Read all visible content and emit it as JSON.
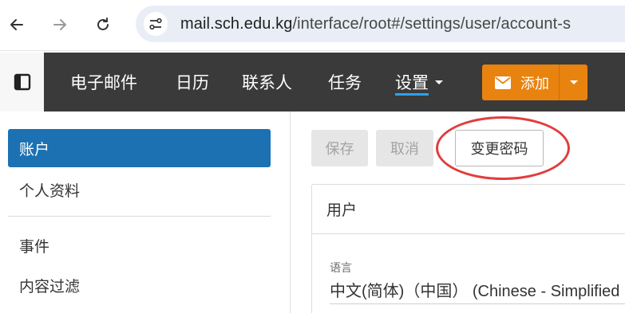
{
  "browser": {
    "back_icon": "arrow-left-icon",
    "forward_icon": "arrow-right-icon",
    "reload_icon": "reload-icon",
    "site_info_icon": "tune-icon",
    "url_host": "mail.sch.edu.kg",
    "url_path": "/interface/root#/settings/user/account-s"
  },
  "nav": {
    "sidebar_toggle_icon": "sidebar-toggle-icon",
    "items": [
      "电子邮件",
      "日历",
      "联系人",
      "任务"
    ],
    "active_item": "设置",
    "add_button_label": "添加",
    "add_icon": "envelope-icon",
    "accent_color": "#e9830f"
  },
  "sidebar": {
    "items": [
      "账户",
      "个人资料",
      "事件",
      "内容过滤"
    ],
    "active_index": 0,
    "active_color": "#1c71b3"
  },
  "toolbar": {
    "save_label": "保存",
    "cancel_label": "取消",
    "change_password_label": "变更密码",
    "highlight_color": "#e23c3c"
  },
  "user_panel": {
    "title": "用户",
    "language_label": "语言",
    "language_value": "中文(简体)（中国） (Chinese - Simplified"
  }
}
